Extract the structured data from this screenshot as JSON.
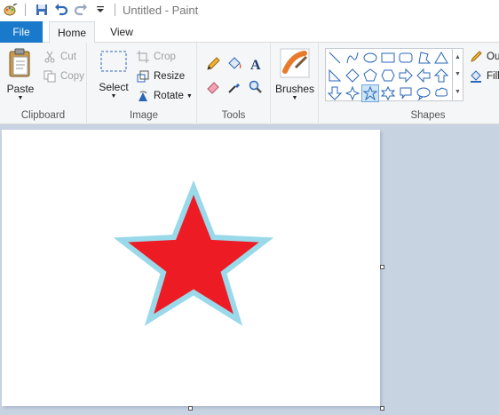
{
  "window": {
    "title": "Untitled - Paint"
  },
  "tabs": [
    {
      "label": "File"
    },
    {
      "label": "Home"
    },
    {
      "label": "View"
    }
  ],
  "clipboard": {
    "group_label": "Clipboard",
    "paste": "Paste",
    "cut": "Cut",
    "copy": "Copy"
  },
  "image": {
    "group_label": "Image",
    "select": "Select",
    "crop": "Crop",
    "resize": "Resize",
    "rotate": "Rotate"
  },
  "tools": {
    "group_label": "Tools"
  },
  "brushes": {
    "label": "Brushes"
  },
  "shapes": {
    "group_label": "Shapes",
    "outline_label": "Ou",
    "fill_label": "Fill",
    "selected_shape": "five-point-star"
  },
  "canvas": {
    "background": "#ffffff",
    "star": {
      "fill": "#ed1c24",
      "outline": "#99d9ea"
    }
  },
  "colors": {
    "file_tab": "#1979ca",
    "ribbon_bg": "#f5f6f7",
    "workspace_bg": "#c8d3e2"
  }
}
